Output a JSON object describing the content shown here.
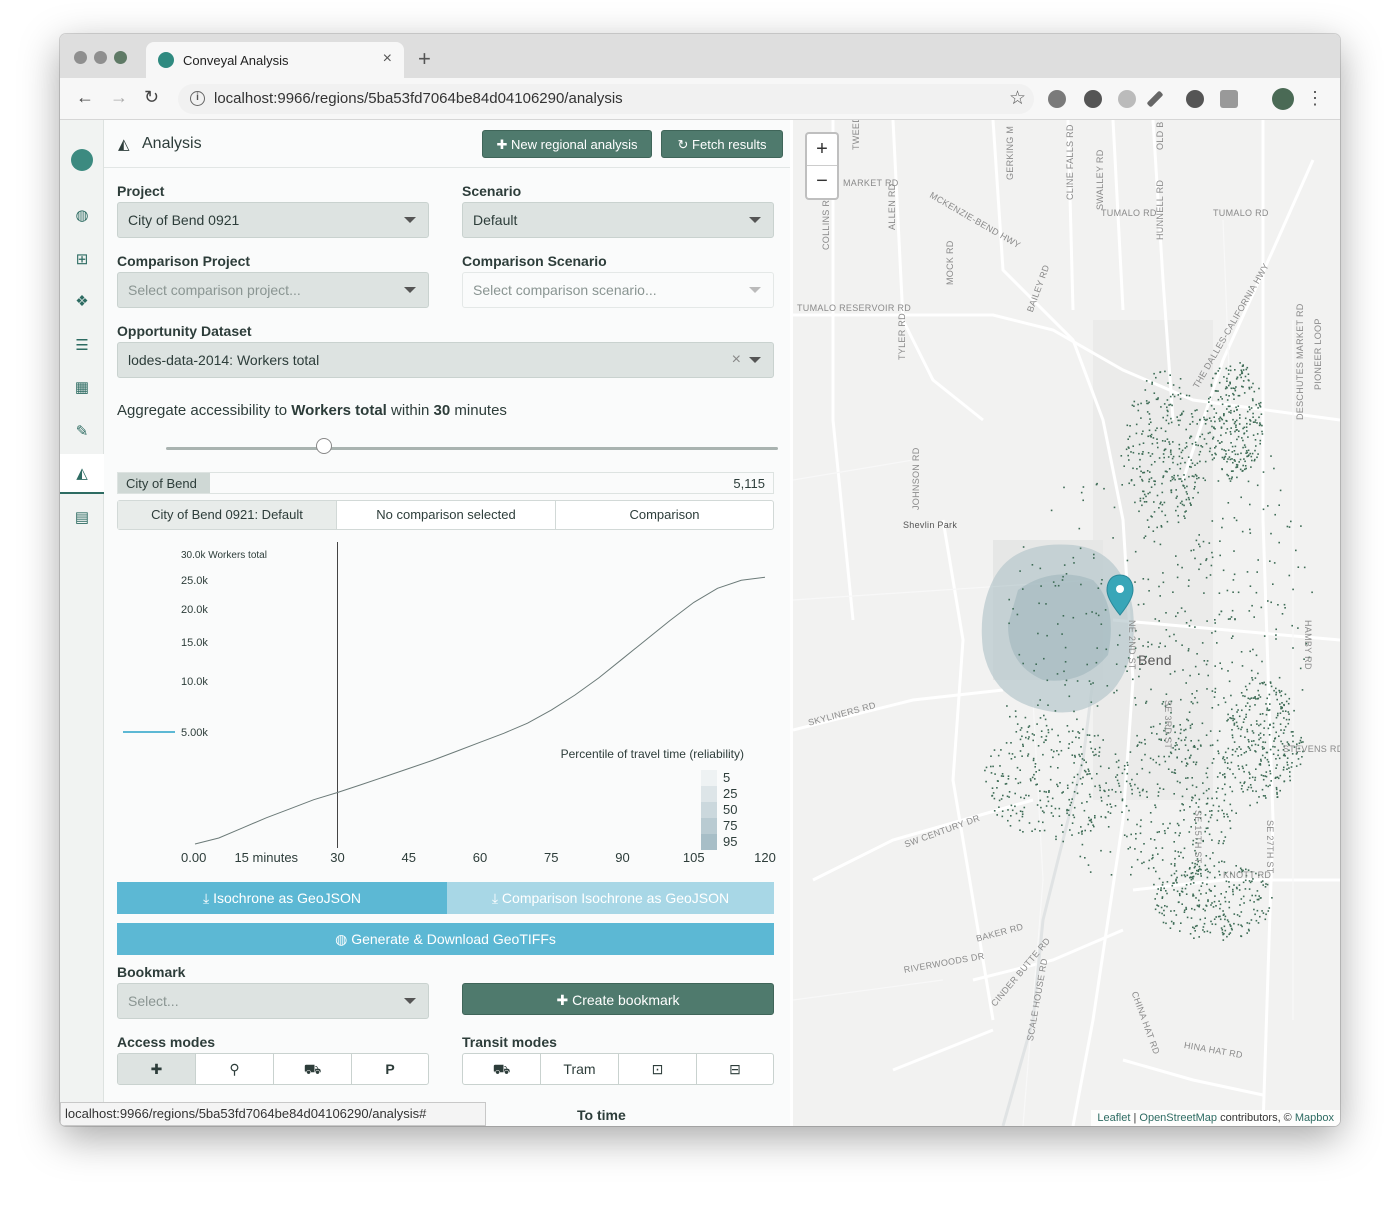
{
  "browser": {
    "tab_title": "Conveyal Analysis",
    "url": "localhost:9966/regions/5ba53fd7064be84d04106290/analysis",
    "status_url": "localhost:9966/regions/5ba53fd7064be84d04106290/analysis#"
  },
  "sidebar": {
    "items": [
      {
        "icon": "globe-icon",
        "glyph": "◍"
      },
      {
        "icon": "map-icon",
        "glyph": "⊞"
      },
      {
        "icon": "cubes-icon",
        "glyph": "❖"
      },
      {
        "icon": "database-icon",
        "glyph": "☰"
      },
      {
        "icon": "grid-icon",
        "glyph": "▦"
      },
      {
        "icon": "pencil-icon",
        "glyph": "✎"
      },
      {
        "icon": "area-chart-icon",
        "glyph": "◭"
      },
      {
        "icon": "server-icon",
        "glyph": "▤"
      }
    ]
  },
  "panel": {
    "title": "Analysis",
    "new_regional_label": "New regional analysis",
    "fetch_results_label": "Fetch results",
    "project_label": "Project",
    "project_value": "City of Bend 0921",
    "scenario_label": "Scenario",
    "scenario_value": "Default",
    "comparison_project_label": "Comparison Project",
    "comparison_project_placeholder": "Select comparison project...",
    "comparison_scenario_label": "Comparison Scenario",
    "comparison_scenario_placeholder": "Select comparison scenario...",
    "opportunity_label": "Opportunity Dataset",
    "opportunity_value": "lodes-data-2014: Workers total",
    "aggregate_prefix": "Aggregate accessibility to ",
    "aggregate_dataset": "Workers total",
    "aggregate_within": " within ",
    "aggregate_minutes": "30",
    "aggregate_suffix": " minutes",
    "slider_value": 0.25,
    "region_name": "City of Bend",
    "region_value": "5,115",
    "region_fill": 0.14,
    "tabs": [
      "City of Bend 0921: Default",
      "No comparison selected",
      "Comparison"
    ],
    "isochrone_label": "Isochrone as GeoJSON",
    "comparison_isochrone_label": "Comparison Isochrone as GeoJSON",
    "geotiff_label": "Generate & Download GeoTIFFs",
    "bookmark_label": "Bookmark",
    "bookmark_placeholder": "Select...",
    "create_bookmark_label": "Create bookmark",
    "access_modes_label": "Access modes",
    "access_modes": [
      {
        "icon": "walk-icon",
        "glyph": "✚"
      },
      {
        "icon": "bicycle-icon",
        "glyph": "⚲"
      },
      {
        "icon": "car-icon",
        "glyph": "⛟"
      },
      {
        "icon": "park-ride-icon",
        "glyph": "P"
      }
    ],
    "transit_modes_label": "Transit modes",
    "transit_modes": [
      {
        "icon": "bus-icon",
        "glyph": "⛟"
      },
      {
        "icon": "tram-label",
        "glyph": "Tram"
      },
      {
        "icon": "subway-icon",
        "glyph": "⊡"
      },
      {
        "icon": "rail-icon",
        "glyph": "⊟"
      }
    ],
    "to_time_label": "To time"
  },
  "chart_data": {
    "type": "line",
    "title": "",
    "ylabel": "Workers total",
    "xlabel": "minutes",
    "xlim": [
      0,
      120
    ],
    "ylim": [
      0,
      30000
    ],
    "x_ticks": [
      "0.00",
      "15 minutes",
      "30",
      "45",
      "60",
      "75",
      "90",
      "105",
      "120"
    ],
    "y_ticks": [
      "5.00k",
      "10.0k",
      "15.0k",
      "20.0k",
      "25.0k",
      "30.0k"
    ],
    "y_top_label": "30.0k Workers total",
    "cutoff": 30,
    "series": [
      {
        "x": [
          0,
          5,
          10,
          15,
          20,
          25,
          30,
          35,
          40,
          45,
          50,
          55,
          60,
          65,
          70,
          75,
          80,
          85,
          90,
          95,
          100,
          105,
          110,
          115,
          120
        ],
        "y": [
          0,
          600,
          1600,
          2600,
          3500,
          4400,
          5115,
          5900,
          6700,
          7500,
          8300,
          9200,
          10100,
          11000,
          12000,
          13300,
          14800,
          16500,
          18400,
          20300,
          22200,
          24000,
          25400,
          26200,
          26500
        ]
      }
    ],
    "legend_marker_value": "5.00k",
    "reliability": {
      "title": "Percentile of travel time (reliability)",
      "levels": [
        "5",
        "25",
        "50",
        "75",
        "95"
      ]
    }
  },
  "map": {
    "zoom_in": "+",
    "zoom_out": "−",
    "attribution_leaflet": "Leaflet",
    "attribution_osm": "OpenStreetMap",
    "attribution_mid": " contributors, © ",
    "attribution_mapbox": "Mapbox",
    "place_labels": [
      "Shevlin Park",
      "Bend"
    ],
    "road_labels": [
      "TWEED RD",
      "GERKING M",
      "CLINE FALLS RD",
      "OLD B",
      "MARKET RD",
      "SWALLEY RD",
      "HUNNELL RD",
      "TUMALO RD",
      "MCKENZIE-BEND HWY",
      "ALLEN RD",
      "COLLINS RD",
      "MOCK RD",
      "BAILEY RD",
      "TUMALO RESERVOIR RD",
      "TYLER RD",
      "JOHNSON RD",
      "SKYLINERS RD",
      "SW CENTURY DR",
      "KNOTT RD",
      "BAKER RD",
      "CINDER BUTTE RD",
      "SCALE HOUSE RD",
      "CHINA HAT RD",
      "HINA HAT RD",
      "RIVERWOODS DR",
      "HAMBY RD",
      "STEVENS RD",
      "PIONEER LOOP",
      "DESCHUTES MARKET RD",
      "THE DALLES-CALIFORNIA HWY",
      "NE 2ND ST",
      "SE 3RD ST",
      "SE 15TH ST",
      "SE 27TH ST"
    ]
  }
}
